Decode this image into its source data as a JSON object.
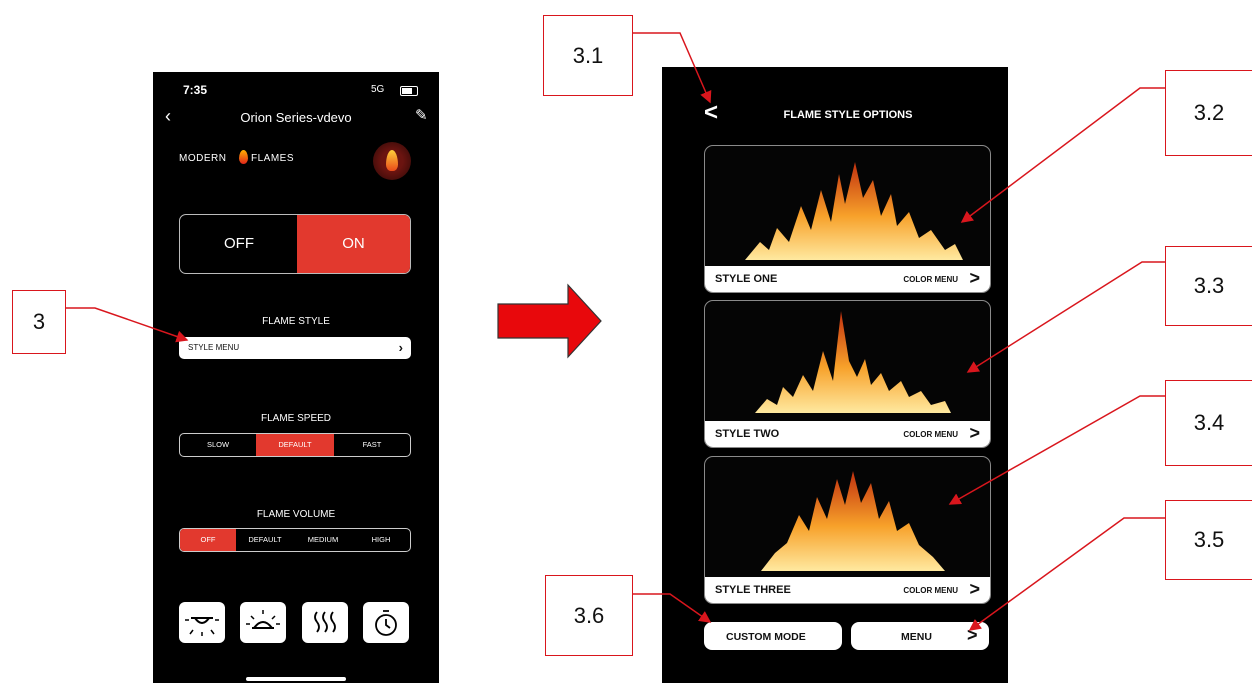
{
  "left_phone": {
    "status_time": "7:35",
    "status_network": "5G",
    "title": "Orion Series-vdevo",
    "back_icon": "chevron-left-icon",
    "edit_icon": "pencil-icon",
    "logo_text_left": "MODERN",
    "logo_text_right": "FLAMES",
    "power": {
      "off_label": "OFF",
      "on_label": "ON",
      "active": "ON"
    },
    "flame_style": {
      "label": "FLAME STYLE",
      "menu_label": "STYLE MENU",
      "chevron": "›"
    },
    "flame_speed": {
      "label": "FLAME SPEED",
      "options": [
        "SLOW",
        "DEFAULT",
        "FAST"
      ],
      "active": "DEFAULT"
    },
    "flame_volume": {
      "label": "FLAME VOLUME",
      "options": [
        "OFF",
        "DEFAULT",
        "MEDIUM",
        "HIGH"
      ],
      "active": "OFF"
    },
    "bottom_icons": [
      "downlight-icon",
      "lamp-icon",
      "heat-icon",
      "timer-icon"
    ]
  },
  "right_phone": {
    "back_label": "<",
    "title": "FLAME STYLE OPTIONS",
    "styles": [
      {
        "name": "STYLE ONE",
        "color_menu": "COLOR MENU",
        "arrow": ">"
      },
      {
        "name": "STYLE TWO",
        "color_menu": "COLOR MENU",
        "arrow": ">"
      },
      {
        "name": "STYLE THREE",
        "color_menu": "COLOR MENU",
        "arrow": ">"
      }
    ],
    "custom_mode_label": "CUSTOM MODE",
    "menu_label": "MENU",
    "menu_arrow": ">"
  },
  "annotations": {
    "callouts": [
      "3",
      "3.1",
      "3.2",
      "3.3",
      "3.4",
      "3.5",
      "3.6"
    ],
    "accent_color": "#e2392e",
    "callout_color": "#d9161d"
  }
}
